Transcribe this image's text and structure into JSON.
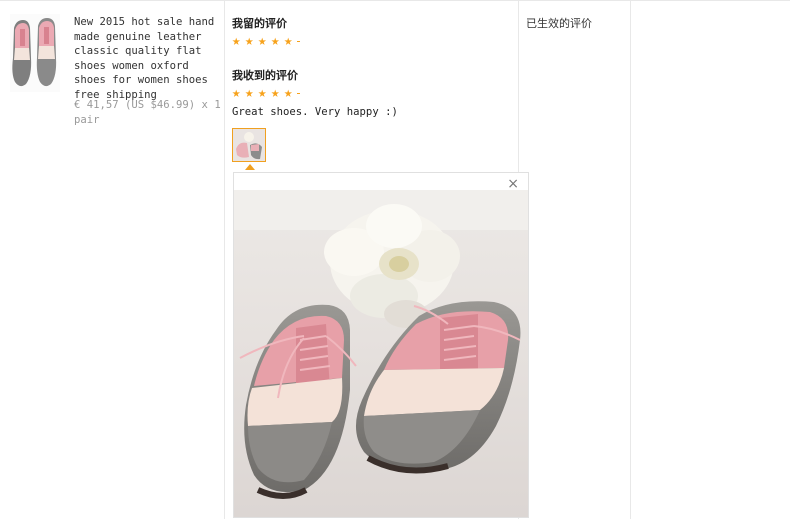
{
  "product": {
    "title": "New 2015 hot sale hand made genuine leather classic quality flat shoes women oxford shoes for women shoes free shipping",
    "price_line": "€ 41,57 (US $46.99) x 1 pair",
    "thumbnail_icon": "pink-grey-oxford-shoes-image"
  },
  "my_review": {
    "heading": "我留的评价",
    "rating": 5
  },
  "received_review": {
    "heading": "我收到的评价",
    "rating": 5,
    "comment": "Great shoes. Very happy :)",
    "photo_icon": "shoes-photo-thumbnail"
  },
  "photo_viewer": {
    "close_label": "×",
    "image_icon": "pink-grey-brogue-shoes-with-white-flower-photo"
  },
  "status": {
    "label": "已生效的评价"
  },
  "colors": {
    "star": "#f7a21b",
    "thumb_border": "#f0a020",
    "divider": "#e8e8e8"
  }
}
